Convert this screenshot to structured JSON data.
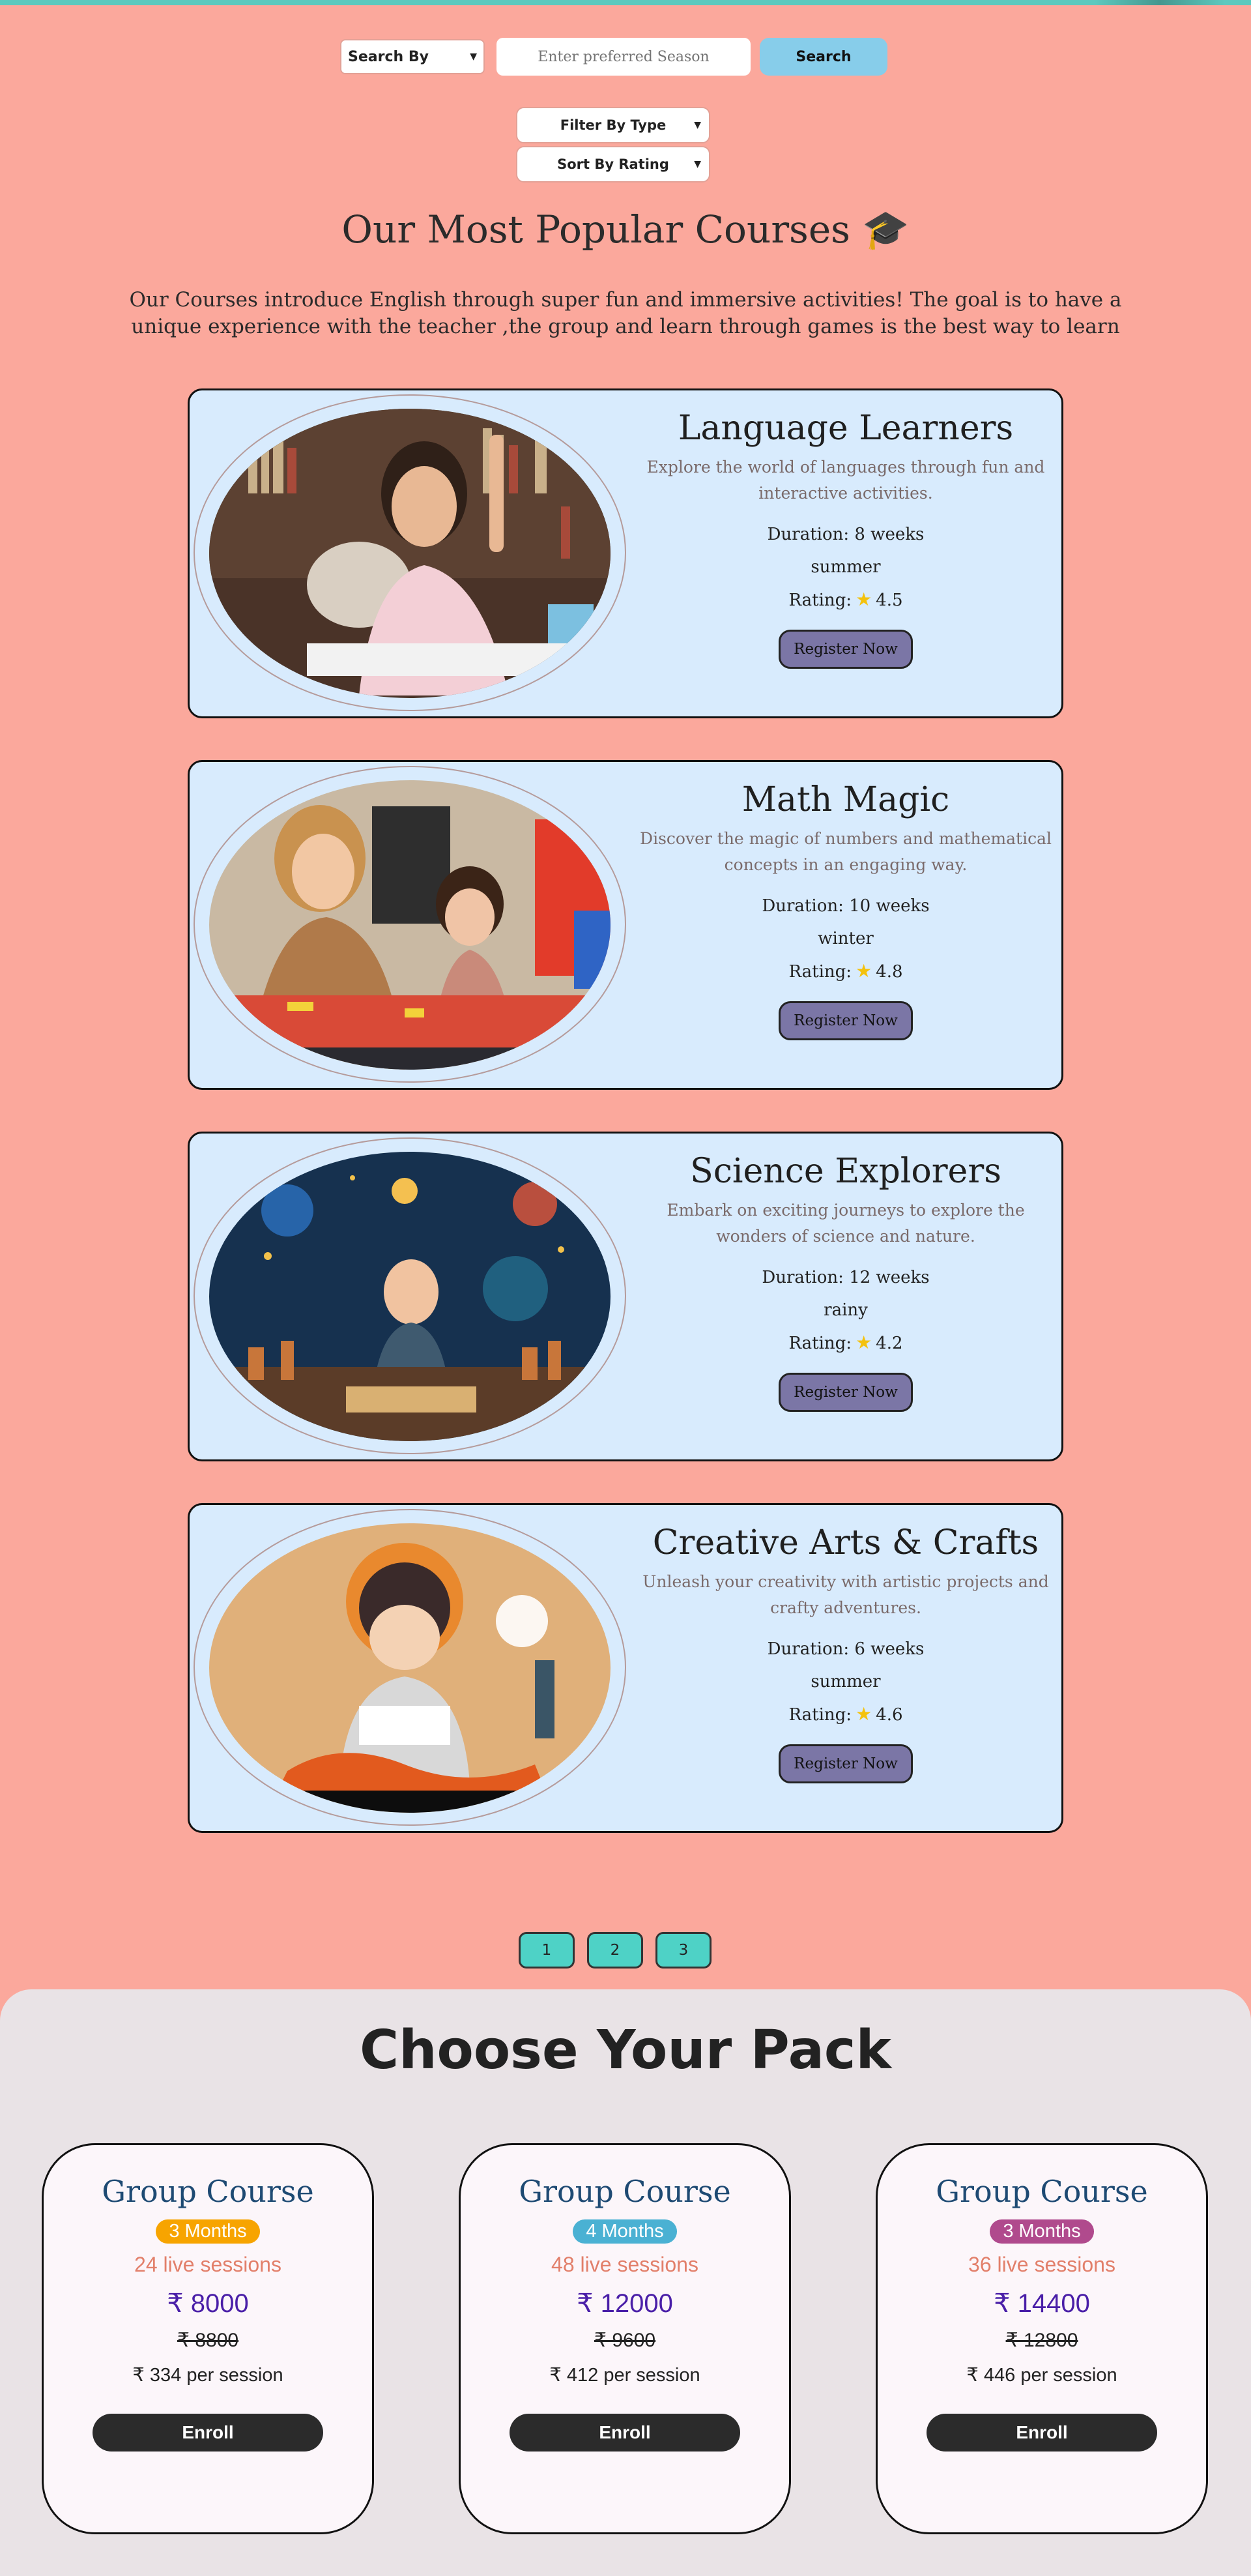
{
  "search": {
    "select_label": "Search By",
    "placeholder": "Enter preferred Season",
    "button_label": "Search"
  },
  "filters": {
    "type_label": "Filter By Type",
    "sort_label": "Sort By Rating"
  },
  "hero": {
    "title": "Our Most Popular Courses 🎓",
    "intro": "Our Courses introduce English through super fun and immersive activities! The goal is to have a unique experience with the teacher ,the group and learn through games is the best way to learn"
  },
  "courses": [
    {
      "title": "Language Learners",
      "description": "Explore the world of languages through fun and interactive activities.",
      "duration": "Duration: 8 weeks",
      "season": "summer",
      "rating_label": "Rating:",
      "rating": "4.5",
      "register": "Register Now"
    },
    {
      "title": "Math Magic",
      "description": "Discover the magic of numbers and mathematical concepts in an engaging way.",
      "duration": "Duration: 10 weeks",
      "season": "winter",
      "rating_label": "Rating:",
      "rating": "4.8",
      "register": "Register Now"
    },
    {
      "title": "Science Explorers",
      "description": "Embark on exciting journeys to explore the wonders of science and nature.",
      "duration": "Duration: 12 weeks",
      "season": "rainy",
      "rating_label": "Rating:",
      "rating": "4.2",
      "register": "Register Now"
    },
    {
      "title": "Creative Arts & Crafts",
      "description": "Unleash your creativity with artistic projects and crafty adventures.",
      "duration": "Duration: 6 weeks",
      "season": "summer",
      "rating_label": "Rating:",
      "rating": "4.6",
      "register": "Register Now"
    }
  ],
  "pagination": [
    "1",
    "2",
    "3"
  ],
  "packs": {
    "title": "Choose Your Pack",
    "items": [
      {
        "name": "Group Course",
        "badge": "3 Months",
        "badge_color": "#f7a400",
        "sessions": "24 live sessions",
        "price": "₹ 8000",
        "old_price": "₹ 8800",
        "per_session": "₹ 334 per session",
        "enroll": "Enroll"
      },
      {
        "name": "Group Course",
        "badge": "4 Months",
        "badge_color": "#4ab1d3",
        "sessions": "48 live sessions",
        "price": "₹ 12000",
        "old_price": "₹ 9600",
        "per_session": "₹ 412 per session",
        "enroll": "Enroll"
      },
      {
        "name": "Group Course",
        "badge": "3 Months",
        "badge_color": "#b04a8d",
        "sessions": "36 live sessions",
        "price": "₹ 14400",
        "old_price": "₹ 12800",
        "per_session": "₹ 446 per session",
        "enroll": "Enroll"
      }
    ]
  },
  "colors": {
    "background": "#fba89c",
    "card": "#d8ebfd",
    "accent": "#5cc9be",
    "search_button": "#87cdea",
    "register_button": "#7b76a6"
  }
}
